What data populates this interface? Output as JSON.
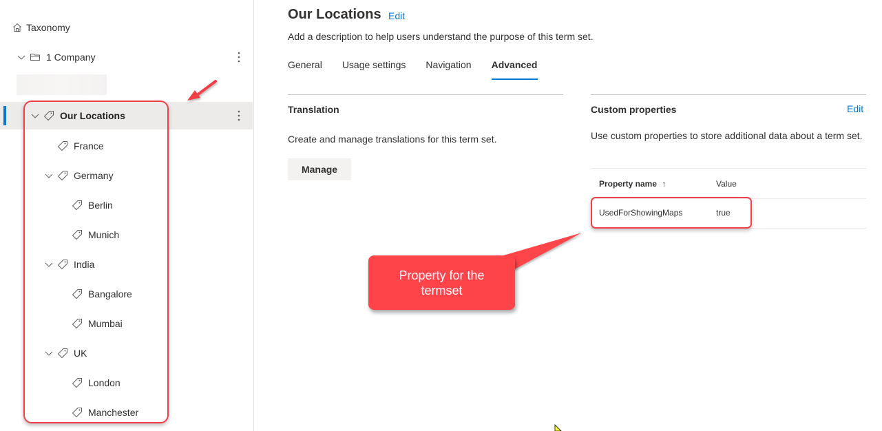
{
  "sidebar": {
    "root": {
      "label": "Taxonomy",
      "icon": "home-icon"
    },
    "group": {
      "label": "1 Company",
      "icon": "folder-icon"
    },
    "termset": {
      "label": "Our Locations",
      "icon": "tag-icon",
      "selected": true
    },
    "terms": [
      {
        "label": "France",
        "level": 1,
        "expandable": false
      },
      {
        "label": "Germany",
        "level": 1,
        "expandable": true
      },
      {
        "label": "Berlin",
        "level": 2,
        "expandable": false
      },
      {
        "label": "Munich",
        "level": 2,
        "expandable": false
      },
      {
        "label": "India",
        "level": 1,
        "expandable": true
      },
      {
        "label": "Bangalore",
        "level": 2,
        "expandable": false
      },
      {
        "label": "Mumbai",
        "level": 2,
        "expandable": false
      },
      {
        "label": "UK",
        "level": 1,
        "expandable": true
      },
      {
        "label": "London",
        "level": 2,
        "expandable": false
      },
      {
        "label": "Manchester",
        "level": 2,
        "expandable": false
      }
    ]
  },
  "main": {
    "title": "Our Locations",
    "title_edit": "Edit",
    "description": "Add a description to help users understand the purpose of this term set.",
    "tabs": [
      {
        "label": "General",
        "active": false
      },
      {
        "label": "Usage settings",
        "active": false
      },
      {
        "label": "Navigation",
        "active": false
      },
      {
        "label": "Advanced",
        "active": true
      }
    ],
    "translation": {
      "title": "Translation",
      "text": "Create and manage translations for this term set.",
      "button": "Manage"
    },
    "custom_properties": {
      "title": "Custom properties",
      "edit": "Edit",
      "text": "Use custom properties to store additional data about a term set.",
      "columns": {
        "name": "Property name",
        "sort_icon": "arrow-up-icon",
        "value": "Value"
      },
      "rows": [
        {
          "name": "UsedForShowingMaps",
          "value": "true"
        }
      ]
    }
  },
  "annotation": {
    "callout_text": "Property for the termset",
    "color": "#fe4449"
  },
  "colors": {
    "accent": "#0078d4",
    "selected_bg": "#edebe9",
    "highlight": "#ef4047"
  }
}
